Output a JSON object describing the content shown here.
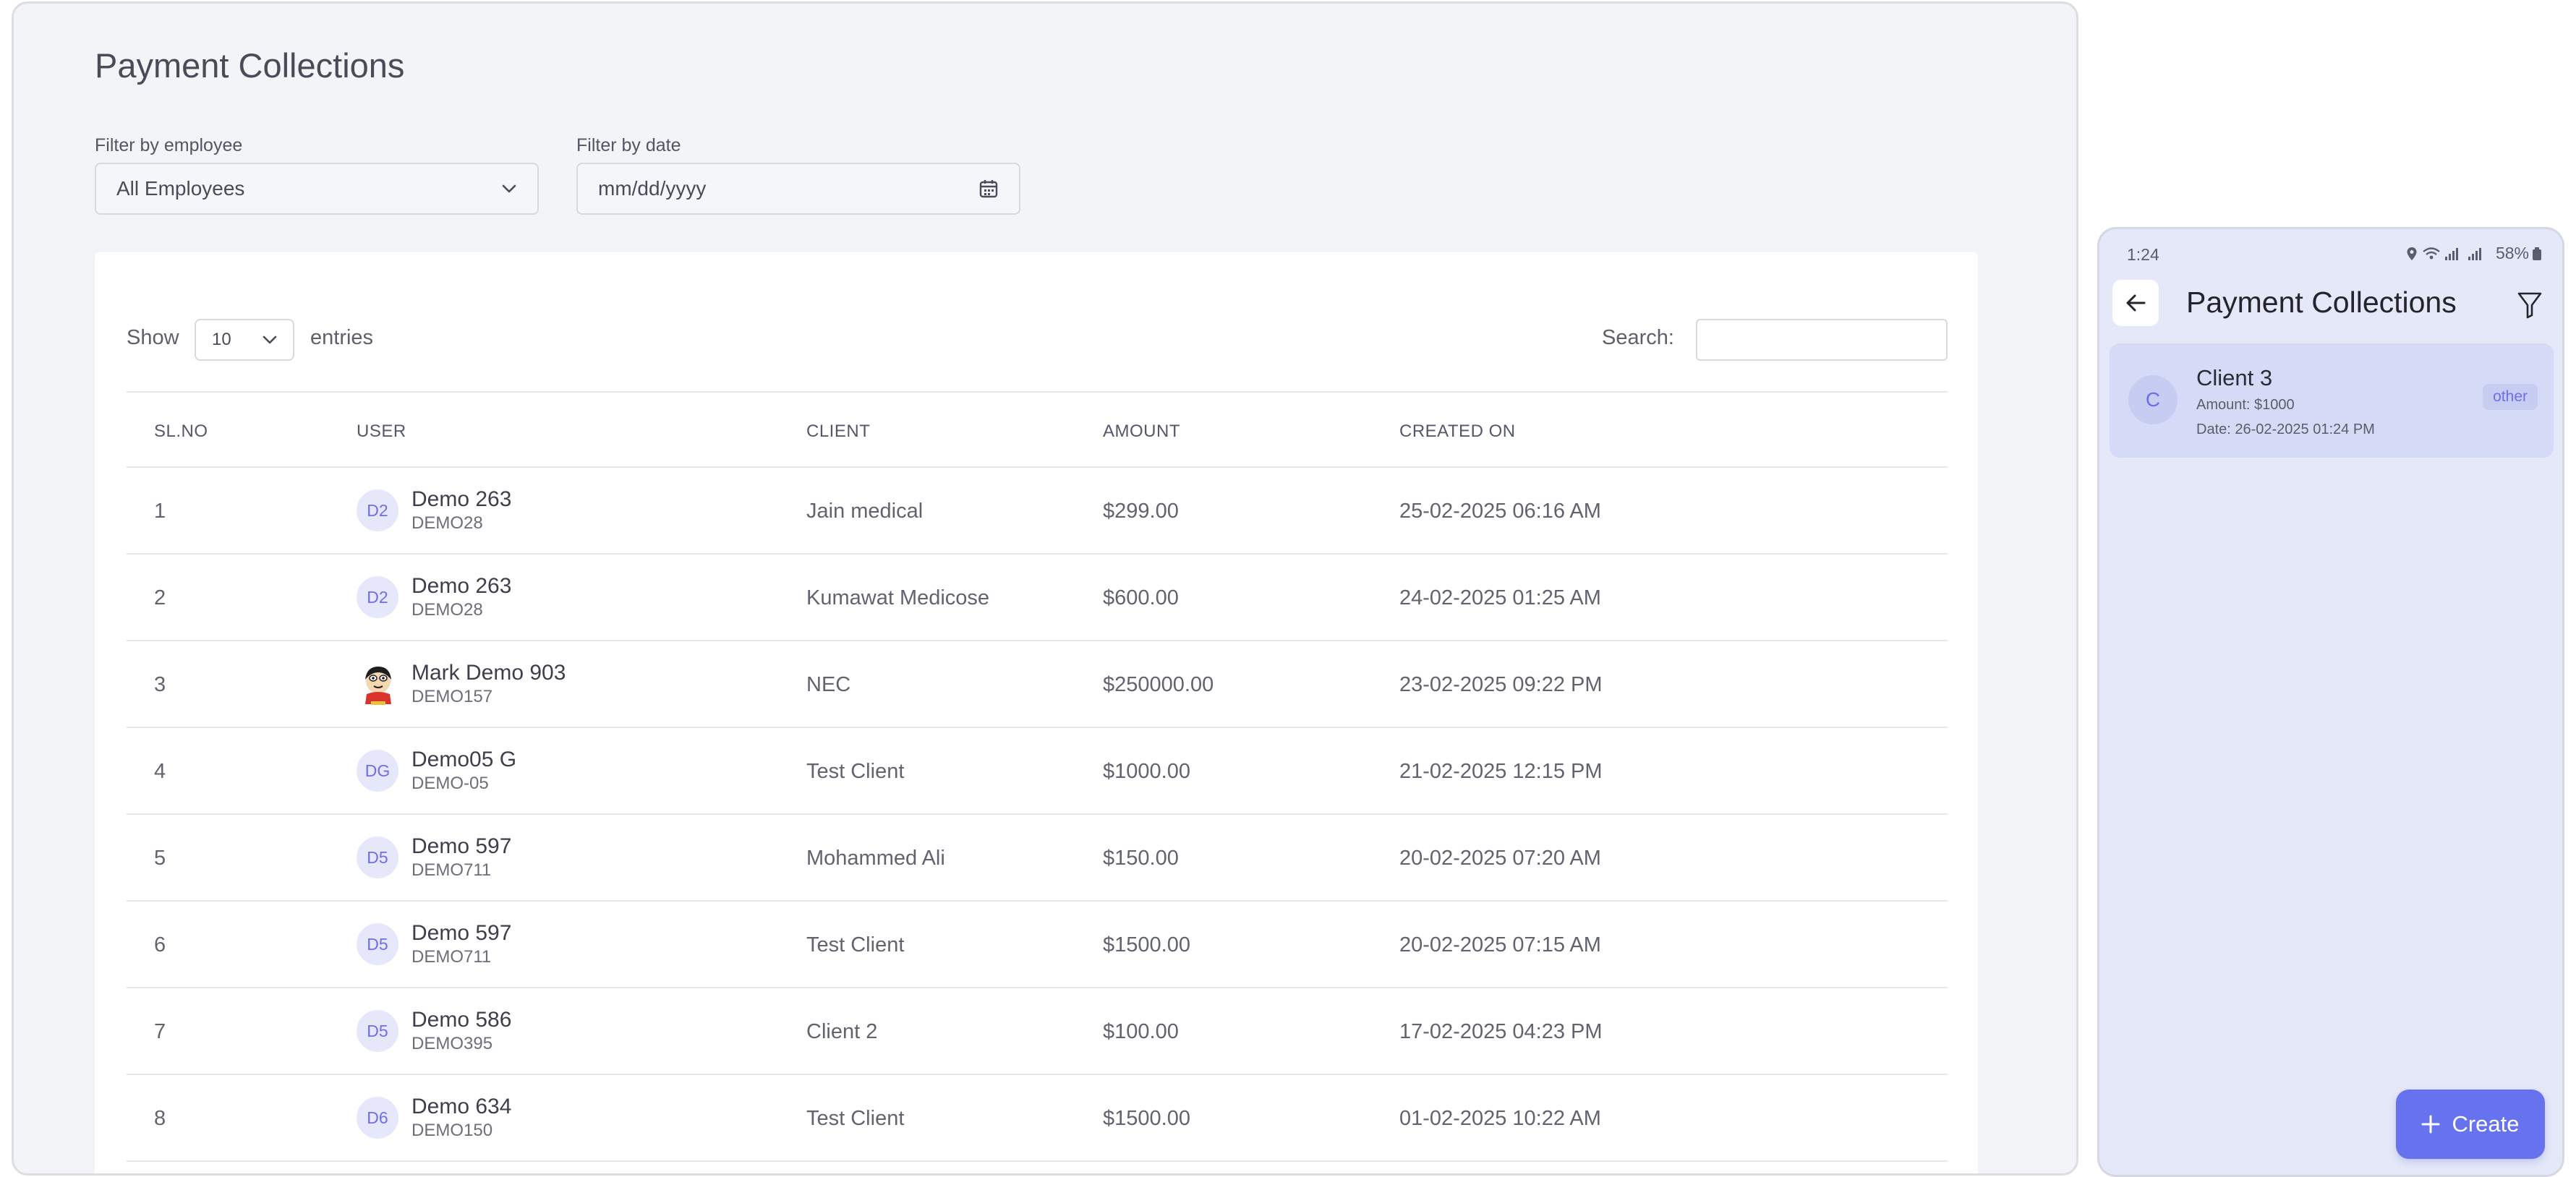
{
  "desktop": {
    "page_title": "Payment Collections",
    "filter_employee": {
      "label": "Filter by employee",
      "value": "All Employees"
    },
    "filter_date": {
      "label": "Filter by date",
      "placeholder": "mm/dd/yyyy"
    },
    "table_controls": {
      "show_label": "Show",
      "page_length": "10",
      "entries_label": "entries",
      "search_label": "Search:"
    },
    "columns": [
      "SL.NO",
      "USER",
      "CLIENT",
      "AMOUNT",
      "CREATED ON"
    ],
    "rows": [
      {
        "sl": "1",
        "avatar": "D2",
        "name": "Demo 263",
        "code": "DEMO28",
        "client": "Jain medical",
        "amount": "$299.00",
        "created": "25-02-2025 06:16 AM"
      },
      {
        "sl": "2",
        "avatar": "D2",
        "name": "Demo 263",
        "code": "DEMO28",
        "client": "Kumawat Medicose",
        "amount": "$600.00",
        "created": "24-02-2025 01:25 AM"
      },
      {
        "sl": "3",
        "avatar": "",
        "name": "Mark Demo 903",
        "code": "DEMO157",
        "client": "NEC",
        "amount": "$250000.00",
        "created": "23-02-2025 09:22 PM"
      },
      {
        "sl": "4",
        "avatar": "DG",
        "name": "Demo05 G",
        "code": "DEMO-05",
        "client": "Test Client",
        "amount": "$1000.00",
        "created": "21-02-2025 12:15 PM"
      },
      {
        "sl": "5",
        "avatar": "D5",
        "name": "Demo 597",
        "code": "DEMO711",
        "client": "Mohammed Ali",
        "amount": "$150.00",
        "created": "20-02-2025 07:20 AM"
      },
      {
        "sl": "6",
        "avatar": "D5",
        "name": "Demo 597",
        "code": "DEMO711",
        "client": "Test Client",
        "amount": "$1500.00",
        "created": "20-02-2025 07:15 AM"
      },
      {
        "sl": "7",
        "avatar": "D5",
        "name": "Demo 586",
        "code": "DEMO395",
        "client": "Client 2",
        "amount": "$100.00",
        "created": "17-02-2025 04:23 PM"
      },
      {
        "sl": "8",
        "avatar": "D6",
        "name": "Demo 634",
        "code": "DEMO150",
        "client": "Test Client",
        "amount": "$1500.00",
        "created": "01-02-2025 10:22 AM"
      }
    ]
  },
  "mobile": {
    "status_time": "1:24",
    "battery": "58%",
    "title": "Payment Collections",
    "card": {
      "avatar": "C",
      "client": "Client 3",
      "amount": "Amount: $1000",
      "date": "Date: 26-02-2025 01:24 PM",
      "badge": "other"
    },
    "create_label": "Create"
  },
  "colors": {
    "accent": "#6672ee",
    "avatar_bg": "#e6e7fb",
    "avatar_text": "#6e6ee6",
    "page_bg": "#f3f4f7",
    "mobile_bg": "#e4e8f8"
  }
}
